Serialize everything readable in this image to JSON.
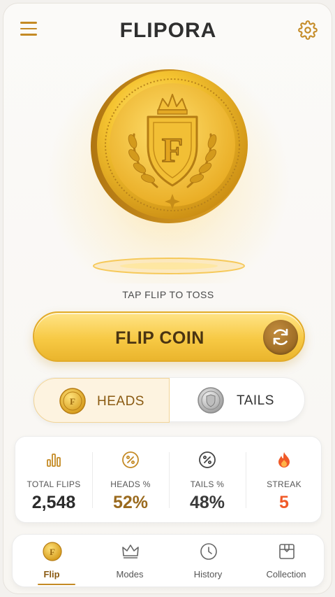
{
  "app": {
    "title": "FLIPORA"
  },
  "coin": {
    "emblem_letter": "F"
  },
  "hint": "TAP FLIP TO TOSS",
  "flip_button": {
    "label": "FLIP COIN"
  },
  "sides": {
    "heads": {
      "label": "HEADS",
      "coin_letter": "F"
    },
    "tails": {
      "label": "TAILS"
    },
    "selected": "heads"
  },
  "stats": [
    {
      "label": "TOTAL FLIPS",
      "value": "2,548",
      "icon": "bar-chart-icon",
      "color": "#2b2b2b"
    },
    {
      "label": "HEADS %",
      "value": "52%",
      "icon": "percent-icon",
      "color": "#9a6a1e"
    },
    {
      "label": "TAILS %",
      "value": "48%",
      "icon": "percent-icon",
      "color": "#3a3a3a"
    },
    {
      "label": "STREAK",
      "value": "5",
      "icon": "flame-icon",
      "color": "#f05a28"
    }
  ],
  "nav": {
    "items": [
      {
        "label": "Flip",
        "icon": "coin-icon",
        "active": true
      },
      {
        "label": "Modes",
        "icon": "crown-icon",
        "active": false
      },
      {
        "label": "History",
        "icon": "clock-icon",
        "active": false
      },
      {
        "label": "Collection",
        "icon": "box-icon",
        "active": false
      }
    ]
  },
  "colors": {
    "accent": "#c48a25",
    "gold_light": "#ffe487",
    "gold_dark": "#eab52d",
    "streak": "#f05a28"
  }
}
